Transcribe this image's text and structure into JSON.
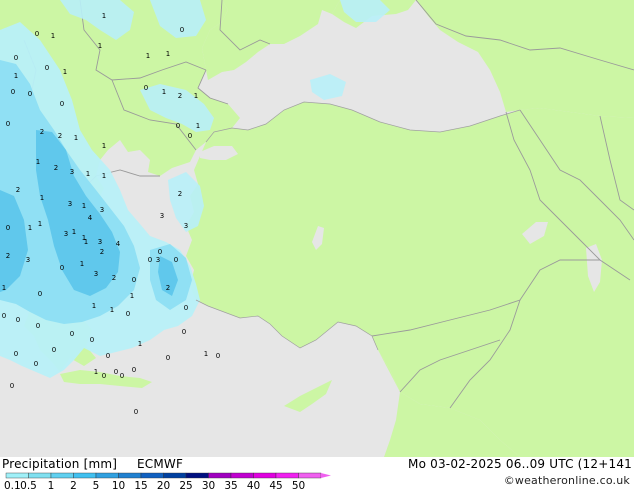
{
  "header": {
    "title": "Precipitation [mm]",
    "model": "ECMWF",
    "validity": "Mo 03-02-2025 06..09 UTC (12+141",
    "credit": "©weatheronline.co.uk"
  },
  "legend": {
    "ticks": [
      "0.1",
      "0.5",
      "1",
      "2",
      "5",
      "10",
      "15",
      "20",
      "25",
      "30",
      "35",
      "40",
      "45",
      "50"
    ],
    "colors": [
      "#a0f0f8",
      "#80e0f0",
      "#60d0f0",
      "#40c0f0",
      "#30a0e0",
      "#2080d0",
      "#1060c0",
      "#0040a0",
      "#001080",
      "#a000c0",
      "#c000d0",
      "#e000e0",
      "#f020f0",
      "#f060f0"
    ]
  },
  "map": {
    "colors": {
      "sea": "#e6e6e6",
      "land": "#ccf6a4",
      "border": "#9a9a9a",
      "precip_light": "#b8f0f8",
      "precip_mid": "#90e0f4",
      "precip_heavy": "#60c8ec"
    },
    "labels": [
      "1",
      "0",
      "1",
      "0",
      "0",
      "1",
      "1",
      "1",
      "1",
      "0",
      "1",
      "0",
      "0",
      "0",
      "0",
      "0",
      "1",
      "2",
      "1",
      "0",
      "1",
      "2",
      "2",
      "1",
      "1",
      "0",
      "1",
      "2",
      "3",
      "1",
      "1",
      "2",
      "1",
      "3",
      "1",
      "3",
      "4",
      "2",
      "3",
      "3",
      "1",
      "3",
      "4",
      "3",
      "1",
      "0",
      "0",
      "0",
      "2",
      "3",
      "0",
      "1",
      "3",
      "2",
      "0",
      "2",
      "1",
      "1",
      "1",
      "0",
      "0",
      "1",
      "0",
      "0",
      "0",
      "0",
      "0",
      "0",
      "1",
      "0",
      "1",
      "0",
      "0",
      "0",
      "0",
      "1",
      "0",
      "0",
      "0",
      "0",
      "0",
      "0",
      "0",
      "0",
      "3",
      "1",
      "2",
      "1",
      "1",
      "0"
    ]
  }
}
